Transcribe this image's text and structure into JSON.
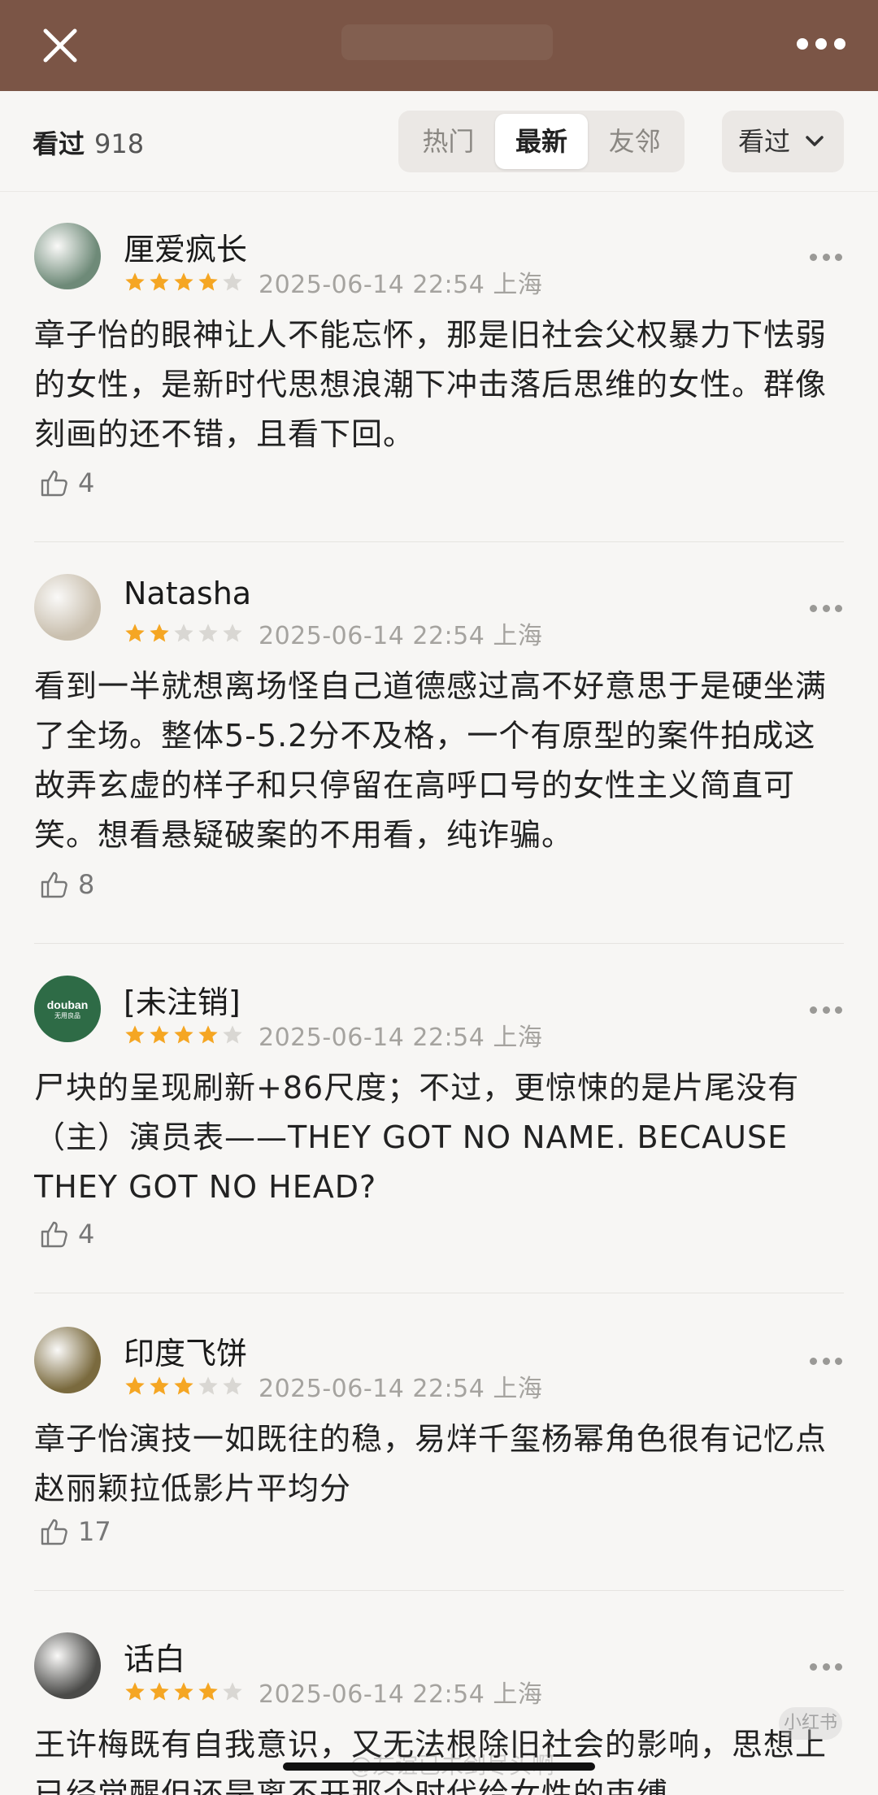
{
  "header": {
    "title": "",
    "close_icon": "close-icon",
    "more_icon": "more-horizontal-icon",
    "bg_color": "#7b5546"
  },
  "filter": {
    "label": "看过",
    "count": "918",
    "tabs": [
      {
        "label": "热门",
        "active": false
      },
      {
        "label": "最新",
        "active": true
      },
      {
        "label": "友邻",
        "active": false
      }
    ],
    "dropdown_label": "看过"
  },
  "reviews": [
    {
      "username": "厘爱疯长",
      "rating": 4,
      "meta": "2025-06-14 22:54 上海",
      "content": "章子怡的眼神让人不能忘怀，那是旧社会父权暴力下怯弱的女性，是新时代思想浪潮下冲击落后思维的女性。群像刻画的还不错，且看下回。",
      "likes": "4",
      "avatar_color": "#6e8a78"
    },
    {
      "username": "Natasha",
      "rating": 2,
      "meta": "2025-06-14 22:54 上海",
      "content": "看到一半就想离场怪自己道德感过高不好意思于是硬坐满了全场。整体5-5.2分不及格，一个有原型的案件拍成这故弄玄虚的样子和只停留在高呼口号的女性主义简直可笑。想看悬疑破案的不用看，纯诈骗。",
      "likes": "8",
      "avatar_color": "#c9bfae"
    },
    {
      "username": "[未注销]",
      "rating": 4,
      "meta": "2025-06-14 22:54 上海",
      "content": "尸块的呈现刷新+86尺度；不过，更惊悚的是片尾没有（主）演员表——THEY GOT NO NAME. BECAUSE THEY GOT NO HEAD?",
      "likes": "4",
      "avatar_color": "#2e6b46",
      "avatar_text": "douban",
      "avatar_subtext": "无用良品"
    },
    {
      "username": "印度飞饼",
      "rating": 3,
      "meta": "2025-06-14 22:54 上海",
      "content": "章子怡演技一如既往的稳，易烊千玺杨幂角色很有记忆点 赵丽颖拉低影片平均分",
      "likes": "17",
      "avatar_color": "#7a6a3e"
    },
    {
      "username": "话白",
      "rating": 4,
      "meta": "2025-06-14 22:54 上海",
      "content": "王许梅既有自我意识，又无法根除旧社会的影响，思想上已经觉醒但还是离不开那个时代给女性的束缚",
      "likes": "",
      "avatar_color": "#4a4a48"
    }
  ],
  "colors": {
    "star_filled": "#f5a623",
    "star_empty": "#d9d7d3",
    "accent": "#7b5546"
  },
  "watermark": "@友谊已未剑尽头啊",
  "corner_badge": "小红书"
}
